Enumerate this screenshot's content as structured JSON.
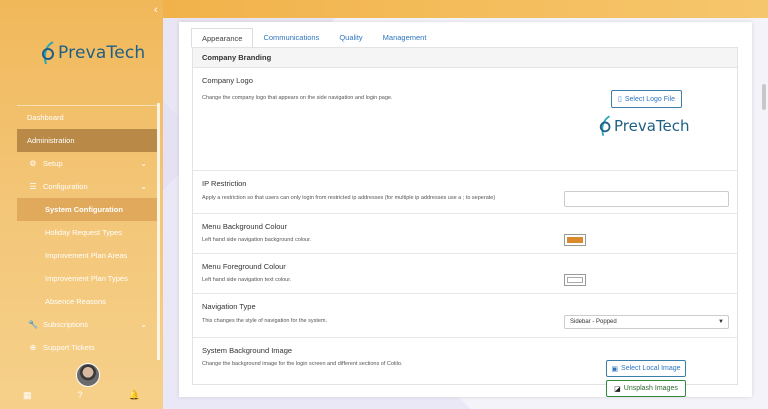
{
  "brand": {
    "name": "PrevaTech",
    "primary": "#1e5f86",
    "accent": "#f1b24a"
  },
  "sidebar": {
    "items": [
      {
        "label": "Dashboard",
        "icon": ""
      },
      {
        "label": "Administration",
        "icon": ""
      },
      {
        "label": "Setup",
        "icon": "gear-icon"
      },
      {
        "label": "Configuration",
        "icon": "list-icon"
      },
      {
        "label": "System Configuration"
      },
      {
        "label": "Holiday Request Types"
      },
      {
        "label": "Improvement Plan Areas"
      },
      {
        "label": "Improvement Plan Types"
      },
      {
        "label": "Absence Reasons"
      },
      {
        "label": "Subscriptions",
        "icon": "wrench-icon"
      },
      {
        "label": "Support Tickets",
        "icon": "plus-circle-icon"
      }
    ]
  },
  "tabs": [
    "Appearance",
    "Communications",
    "Quality",
    "Management"
  ],
  "section_title": "Company Branding",
  "rows": {
    "logo": {
      "title": "Company Logo",
      "desc": "Change the company logo that appears on the side navigation and login page.",
      "button": "Select Logo File"
    },
    "ip": {
      "title": "IP Restriction",
      "desc": "Apply a restriction so that users can only login from restricted ip addresses (for multiple ip addresses use a ; to seperate)",
      "value": ""
    },
    "menu_bg": {
      "title": "Menu Background Colour",
      "desc": "Left hand side navigation background colour.",
      "color": "#d98b2b"
    },
    "menu_fg": {
      "title": "Menu Foreground Colour",
      "desc": "Left hand side navigation text colour.",
      "color": "#ffffff"
    },
    "nav_type": {
      "title": "Navigation Type",
      "desc": "This changes the style of navigation for the system.",
      "selected": "Sidebar - Popped"
    },
    "sys_bg": {
      "title": "System Background Image",
      "desc": "Change the background image for the login screen and different sections of Cotilo.",
      "local_button": "Select Local Image",
      "unsplash_button": "Unsplash Images"
    }
  }
}
